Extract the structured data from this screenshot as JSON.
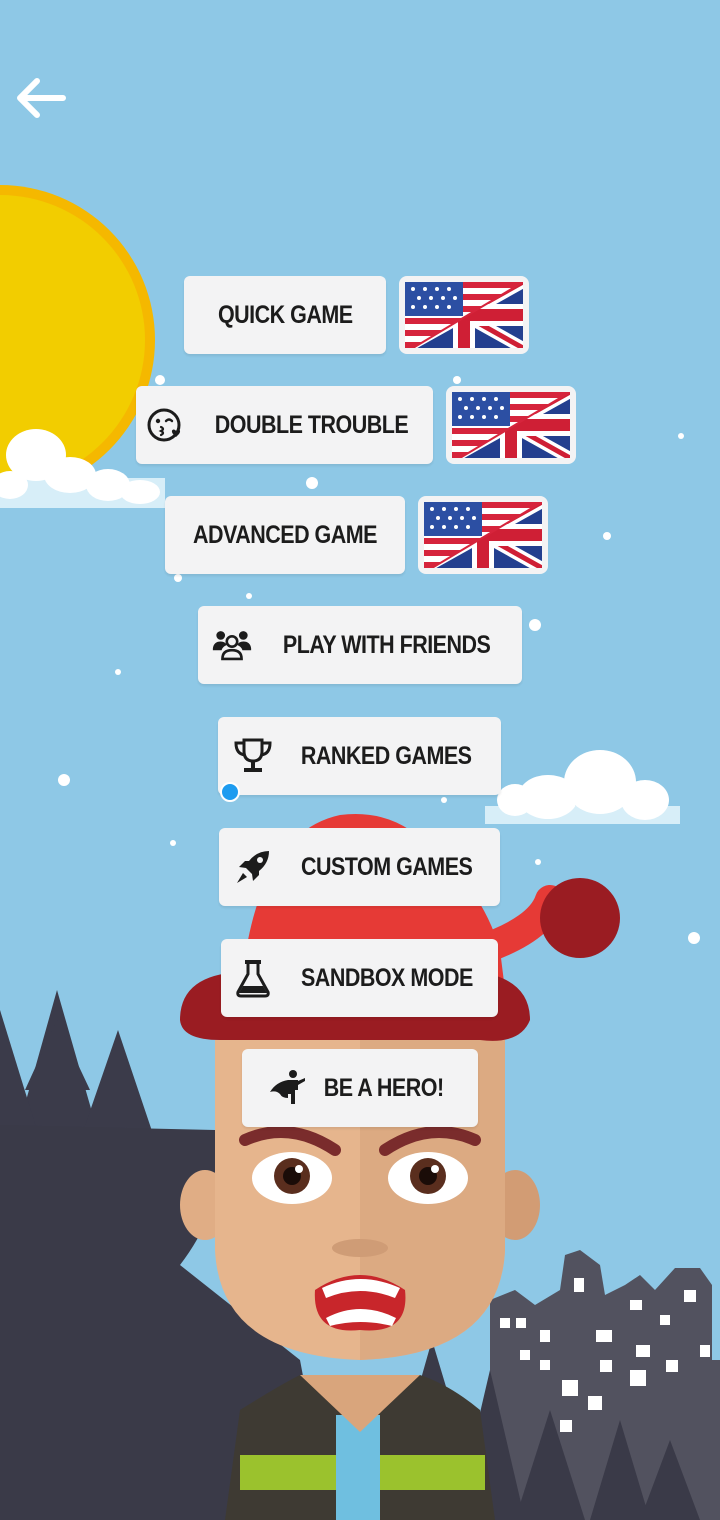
{
  "icons": {
    "back": "arrow-left-icon",
    "double_trouble": "kiss-wink-heart-icon",
    "play_with_friends": "users-icon",
    "ranked_games": "trophy-icon",
    "custom_games": "rocket-icon",
    "sandbox_mode": "flask-icon",
    "be_a_hero": "caped-hero-icon",
    "language_flag": "us-uk-flag-icon"
  },
  "menu": {
    "quick_game": "QUICK GAME",
    "double_trouble": "DOUBLE TROUBLE",
    "advanced_game": "ADVANCED GAME",
    "play_with_friends": "PLAY WITH FRIENDS",
    "ranked_games": "RANKED GAMES",
    "custom_games": "CUSTOM GAMES",
    "sandbox_mode": "SANDBOX MODE",
    "be_a_hero": "BE A HERO!"
  },
  "colors": {
    "sky": "#8ec8e6",
    "sun": "#f2cd00",
    "button_bg": "#f3f3f4",
    "hat_red": "#e53935",
    "hill_dark": "#3a3a48"
  }
}
